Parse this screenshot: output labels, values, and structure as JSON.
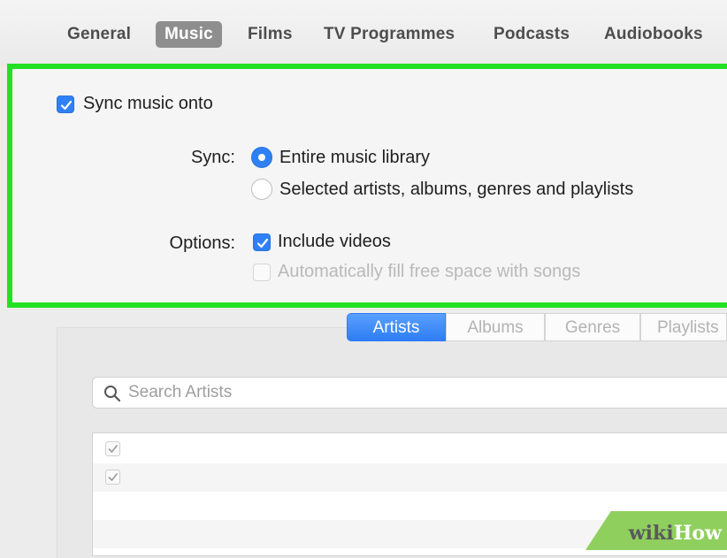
{
  "tabs": [
    "General",
    "Music",
    "Films",
    "TV Programmes",
    "Podcasts",
    "Audiobooks"
  ],
  "active_tab": "Music",
  "sync": {
    "sync_music_label": "Sync music onto",
    "sync_music_checked": true,
    "sync_label": "Sync:",
    "option_entire": "Entire music library",
    "option_selected": "Selected artists, albums, genres and playlists",
    "selected_option": "Entire music library",
    "options_label": "Options:",
    "include_videos": "Include videos",
    "include_videos_checked": true,
    "auto_fill": "Automatically fill free space with songs",
    "auto_fill_checked": false
  },
  "browser": {
    "segments": [
      "Artists",
      "Albums",
      "Genres",
      "Playlists"
    ],
    "active_segment": "Artists",
    "search_placeholder": "Search Artists"
  },
  "watermark": {
    "wiki": "wiki",
    "how": "How"
  },
  "colors": {
    "accent": "#2f80f5",
    "highlight_border": "#22e022",
    "active_tab_bg": "#8e8e8e"
  }
}
